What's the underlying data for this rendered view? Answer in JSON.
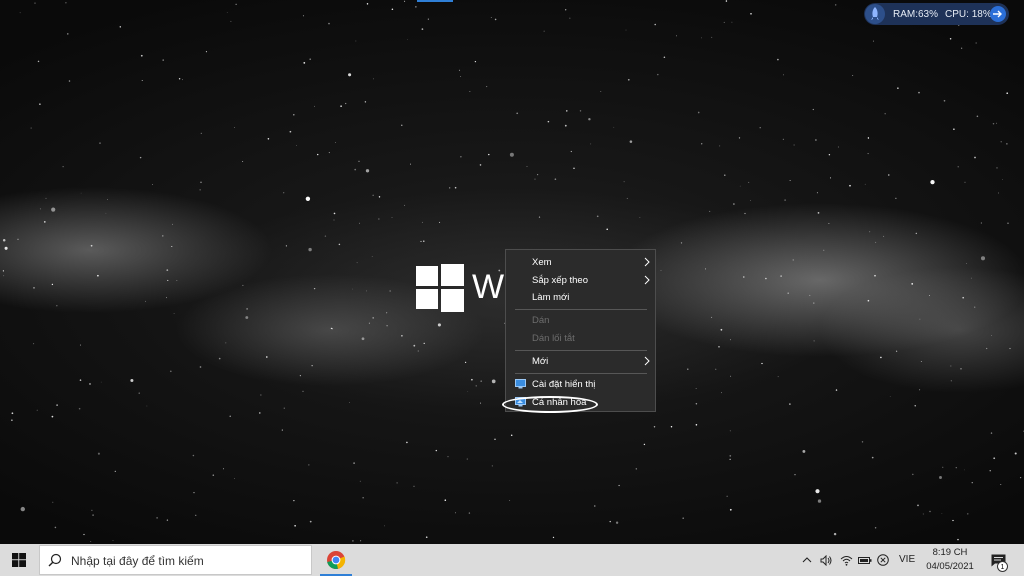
{
  "desktop": {
    "logo_text": "Wi"
  },
  "perf_widget": {
    "ram_label": "RAM:",
    "ram_value": "63",
    "ram_unit": "%",
    "cpu_label": "CPU:",
    "cpu_value": "18",
    "cpu_unit": "%"
  },
  "context_menu": {
    "items": [
      {
        "label": "Xem",
        "has_submenu": true,
        "disabled": false
      },
      {
        "label": "Sắp xếp theo",
        "has_submenu": true,
        "disabled": false
      },
      {
        "label": "Làm mới",
        "has_submenu": false,
        "disabled": false
      },
      {
        "label": "Dán",
        "has_submenu": false,
        "disabled": true
      },
      {
        "label": "Dán lối tắt",
        "has_submenu": false,
        "disabled": true
      },
      {
        "label": "Mới",
        "has_submenu": true,
        "disabled": false
      },
      {
        "label": "Cài đặt hiển thị",
        "has_submenu": false,
        "disabled": false,
        "icon": "display-settings-icon"
      },
      {
        "label": "Cá nhân hóa",
        "has_submenu": false,
        "disabled": false,
        "icon": "personalize-icon"
      }
    ],
    "submenu_arrow": ">"
  },
  "taskbar": {
    "search_placeholder": "Nhập tại đây để tìm kiếm",
    "language": "VIE",
    "time": "8:19 CH",
    "date": "04/05/2021",
    "notification_count": "1"
  },
  "colors": {
    "accent": "#2f7fd6",
    "menu_bg": "#2b2b2b",
    "taskbar_bg": "#dcdcdc",
    "widget_bg": "#1e3258"
  }
}
